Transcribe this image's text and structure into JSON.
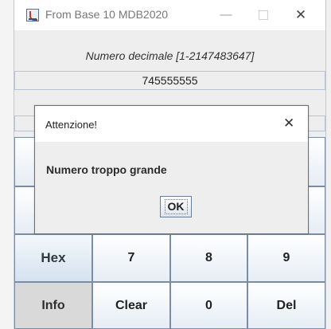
{
  "window": {
    "title": "From Base 10 MDB2020",
    "minimize_glyph": "—",
    "close_glyph": "✕"
  },
  "input_label": "Numero decimale [1-2147483647]",
  "input_value": "745555555",
  "keypad": {
    "row_hex": [
      "Hex",
      "7",
      "8",
      "9"
    ],
    "row_info": [
      "Info",
      "Clear",
      "0",
      "Del"
    ]
  },
  "dialog": {
    "title": "Attenzione!",
    "message": "Numero troppo grande",
    "ok_label": "OK",
    "close_glyph": "✕"
  },
  "colors": {
    "window_bg": "#eeeeee",
    "key_border": "#7a8da4",
    "field_border": "#b8c4d3"
  }
}
